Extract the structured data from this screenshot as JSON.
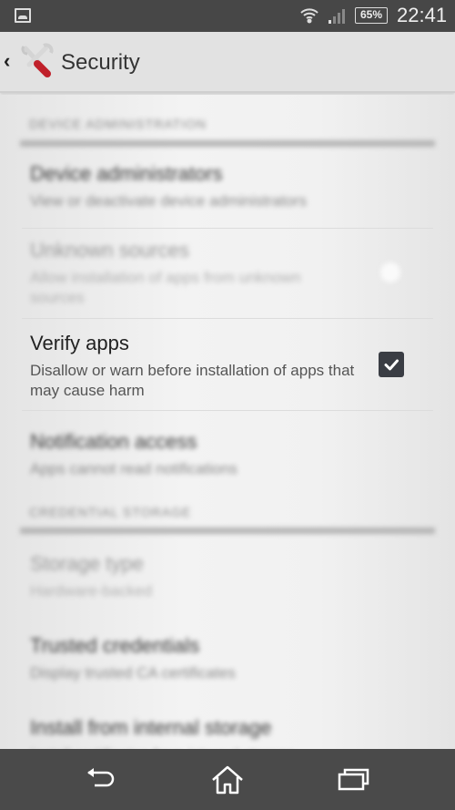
{
  "status_bar": {
    "notification_icon": "image-icon",
    "wifi_icon": "wifi-icon",
    "signal_icon": "cell-signal-icon",
    "battery_percent": "65%",
    "time": "22:41"
  },
  "action_bar": {
    "back_icon": "chevron-left-icon",
    "app_icon": "settings-tools-icon",
    "title": "Security"
  },
  "sections": [
    {
      "header": "Device administration",
      "items": [
        {
          "title": "Device administrators",
          "summary": "View or deactivate device administrators",
          "control": "none"
        },
        {
          "title": "Unknown sources",
          "summary": "Allow installation of apps from unknown sources",
          "control": "checkbox",
          "checked": false
        },
        {
          "title": "Verify apps",
          "summary": "Disallow or warn before installation of apps that may cause harm",
          "control": "checkbox",
          "checked": true
        },
        {
          "title": "Notification access",
          "summary": "Apps cannot read notifications",
          "control": "none"
        }
      ]
    },
    {
      "header": "Credential storage",
      "items": [
        {
          "title": "Storage type",
          "summary": "Hardware-backed",
          "control": "none"
        },
        {
          "title": "Trusted credentials",
          "summary": "Display trusted CA certificates",
          "control": "none"
        },
        {
          "title": "Install from internal storage",
          "summary": "Install certificates from internal storage",
          "control": "none"
        }
      ]
    }
  ],
  "nav_bar": {
    "back": "back-icon",
    "home": "home-icon",
    "recents": "recent-apps-icon"
  },
  "colors": {
    "status_bar_bg": "#474747",
    "nav_bar_bg": "#4a4a4a",
    "checkbox_fill": "#3a3d44",
    "accent_red": "#c0202a"
  }
}
